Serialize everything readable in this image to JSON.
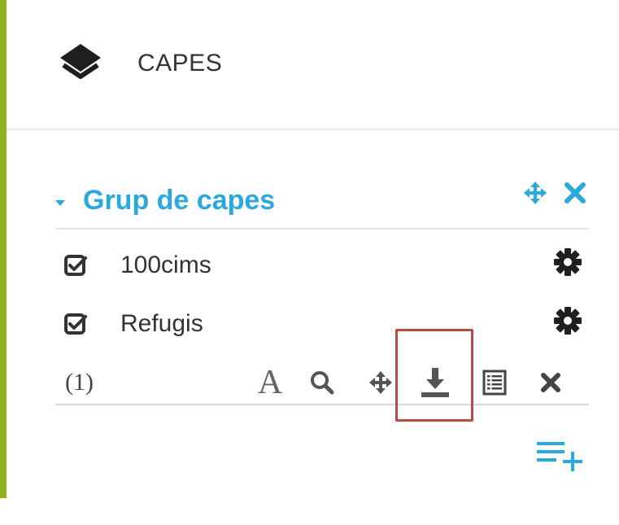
{
  "header": {
    "title": "CAPES",
    "icon": "layers-icon"
  },
  "group": {
    "title": "Grup de capes",
    "icons": [
      "caret-down-icon",
      "move-icon",
      "close-icon"
    ],
    "accent_color": "#2aa9de"
  },
  "layers": [
    {
      "label": "100cims",
      "checked": true,
      "icon": "gear-icon"
    },
    {
      "label": "Refugis",
      "checked": true,
      "icon": "gear-icon"
    }
  ],
  "tools": {
    "count": "(1)",
    "font_glyph": "A",
    "icons": [
      "font-icon",
      "zoom-icon",
      "move-icon",
      "download-icon",
      "table-icon",
      "remove-icon"
    ]
  },
  "highlight": {
    "target": "download-icon",
    "color": "#b84a47"
  },
  "add_layer_icon": "add-layer-icon",
  "sidebar_accent_color": "#8fb21e"
}
